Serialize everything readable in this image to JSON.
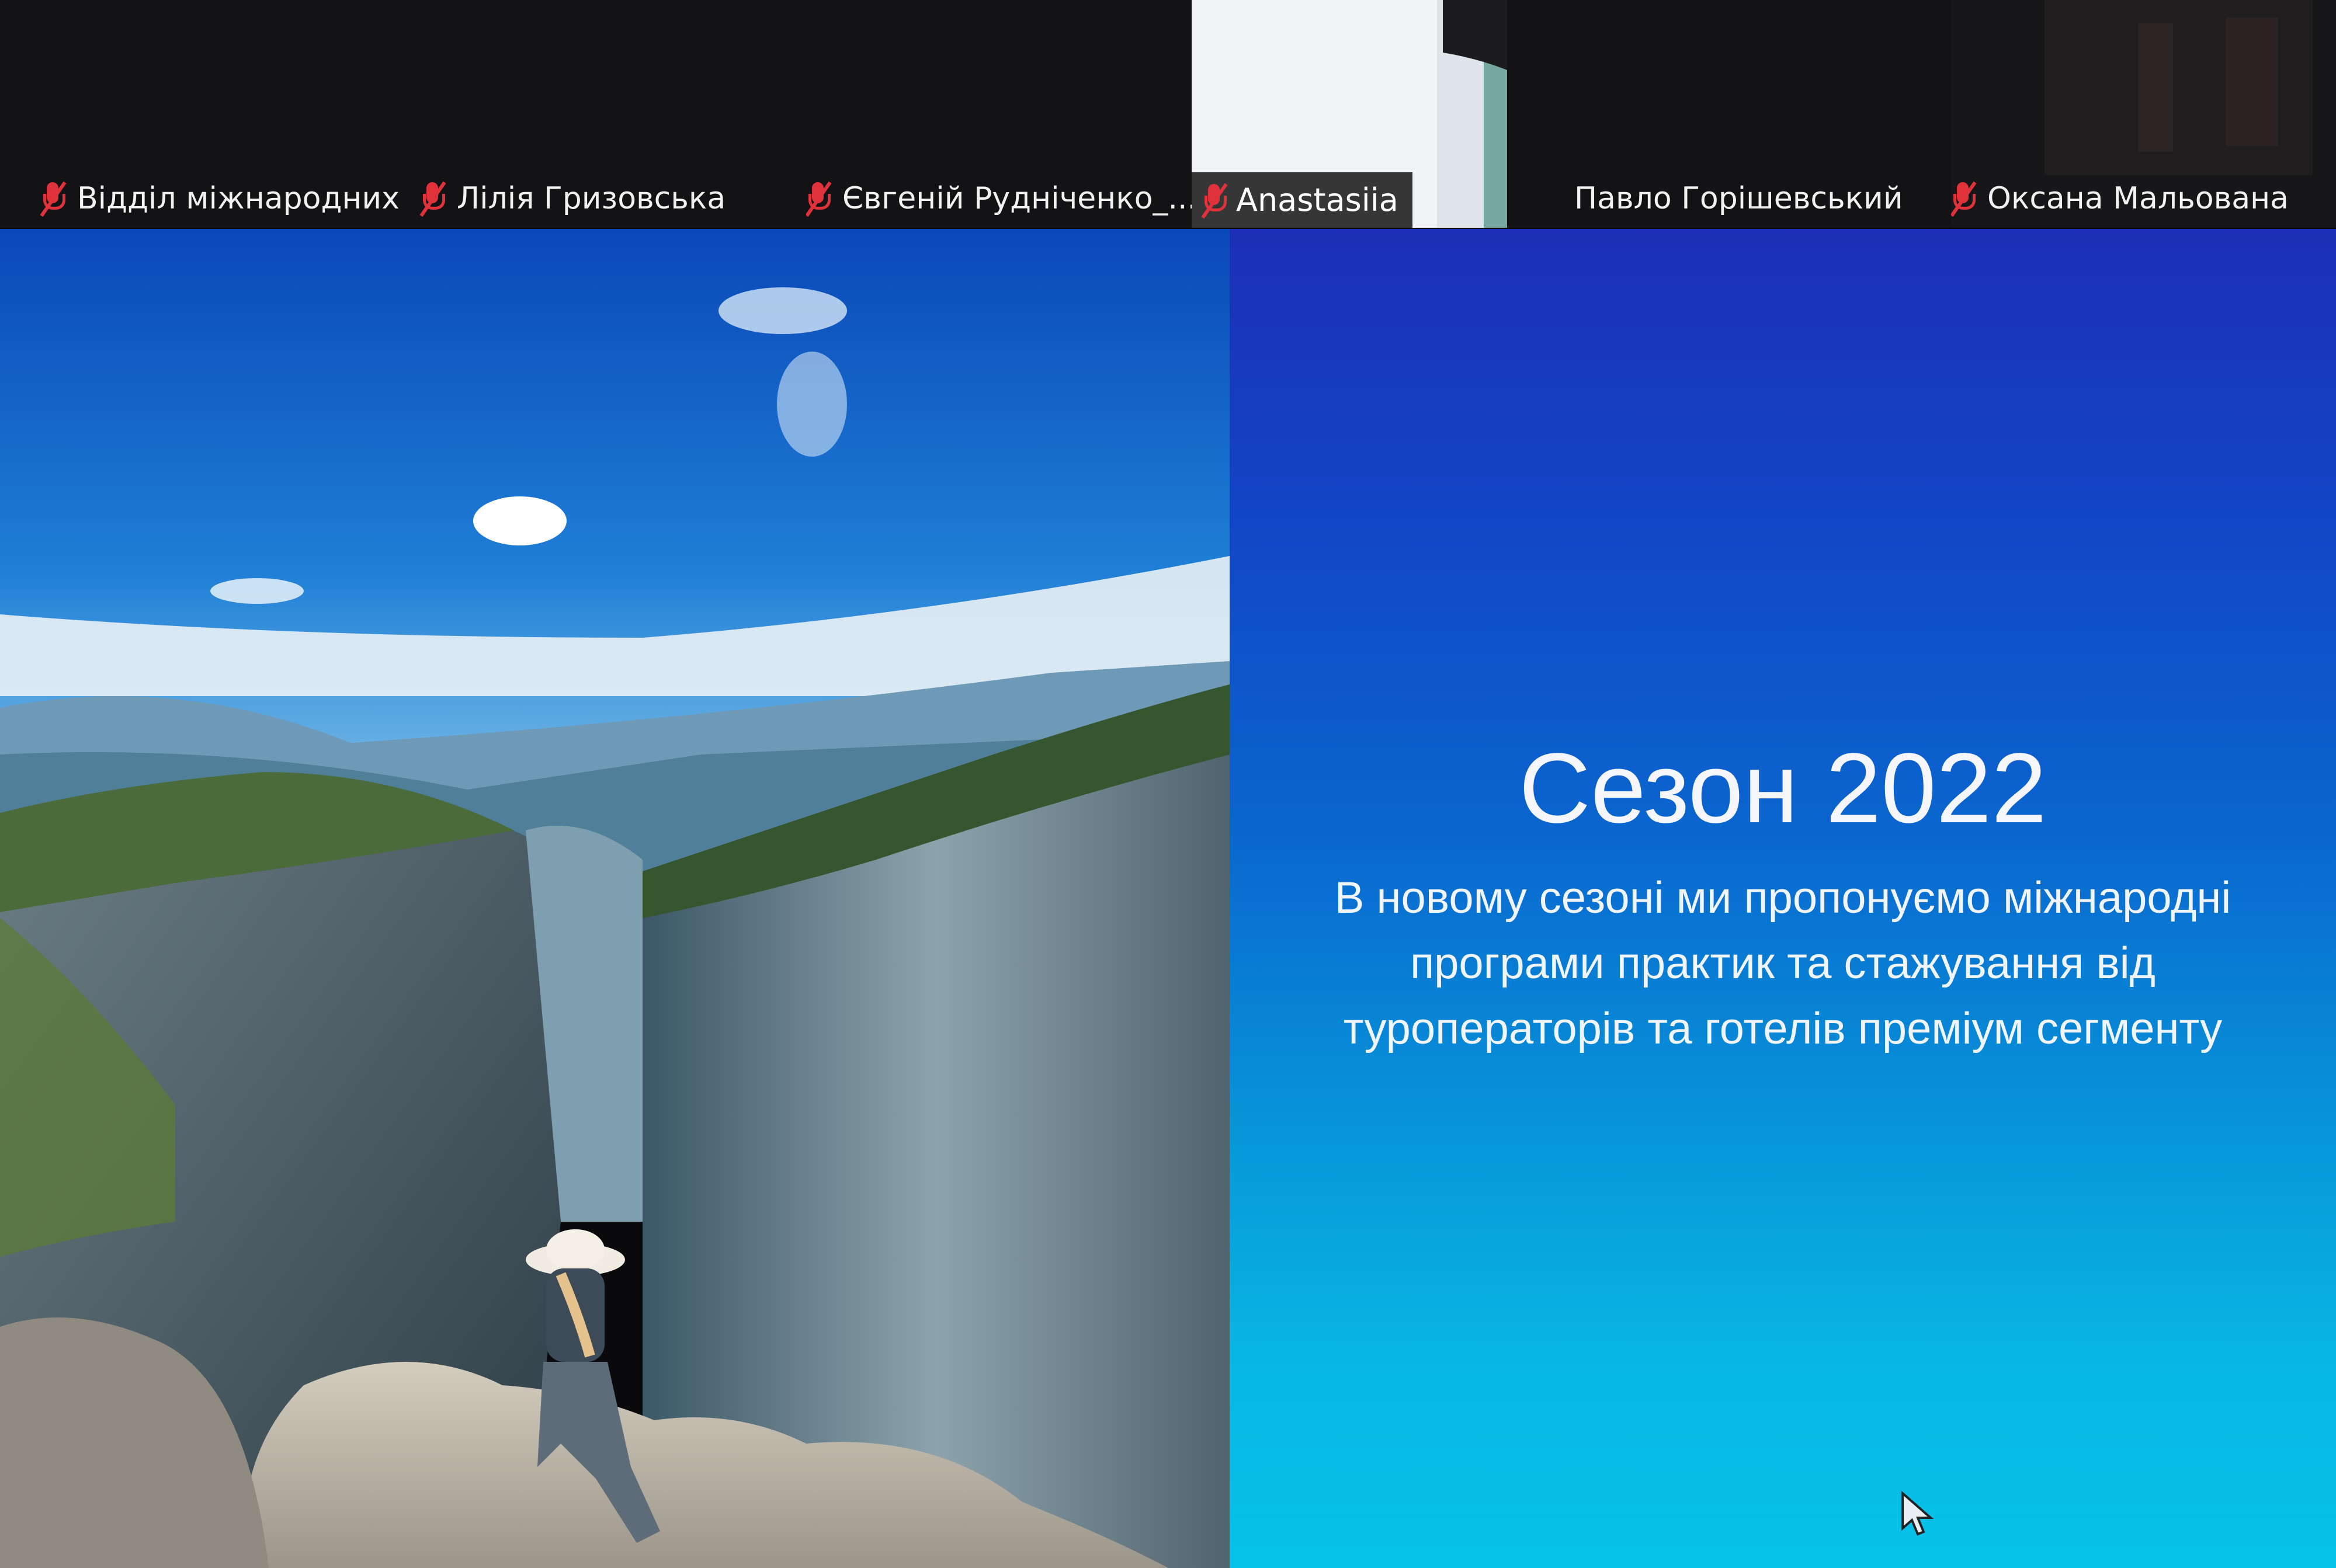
{
  "participants": [
    {
      "name": "Відділ міжнародних з...",
      "muted": true
    },
    {
      "name": "Лілія Гризовська",
      "muted": true
    },
    {
      "name": "Євгеній Рудніченко_...",
      "muted": true
    },
    {
      "name": "Anastasiia",
      "muted": true,
      "video": true
    },
    {
      "name": "Павло Горішевський",
      "muted": false
    },
    {
      "name": "Оксана Мальована",
      "muted": true
    }
  ],
  "slide": {
    "title": "Сезон 2022",
    "lines": [
      "В новому сезоні ми пропонуємо міжнародні",
      "програми практик та стажування від",
      "туроператорів та готелів преміум сегменту"
    ]
  },
  "colors": {
    "mic_muted": "#e0323a",
    "slide_top": "#1c2fb6",
    "slide_bottom": "#06c2e8"
  },
  "icons": [
    "mic-off-icon",
    "mouse-cursor-icon"
  ]
}
